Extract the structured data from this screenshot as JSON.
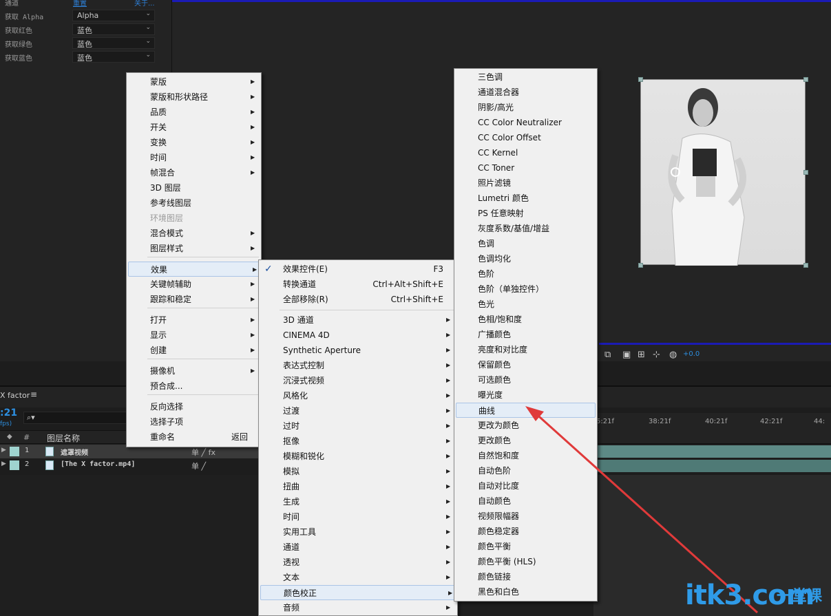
{
  "effect_controls": {
    "top_partial_label": "通道",
    "reset_link": "重置",
    "about_link": "关于...",
    "rows": [
      {
        "label": "获取 Alpha",
        "value": "Alpha"
      },
      {
        "label": "获取红色",
        "value": "蓝色"
      },
      {
        "label": "获取绿色",
        "value": "蓝色"
      },
      {
        "label": "获取蓝色",
        "value": "蓝色"
      }
    ]
  },
  "viewer": {
    "exposure_value": "+0.0"
  },
  "timeline": {
    "tab_label": "X factor",
    "menu_icon": "hamburger-icon",
    "timecode": ":21",
    "fps": "fps)",
    "search_icon": "search-icon",
    "columns": {
      "number": "#",
      "layer_name": "图层名称"
    },
    "layers": [
      {
        "num": "1",
        "name": "遮罩视频",
        "switches": "单  ╱  fx"
      },
      {
        "num": "2",
        "name": "[The X factor.mp4]",
        "switches": "单  ╱"
      }
    ],
    "ruler_ticks": [
      "5:21f",
      "38:21f",
      "40:21f",
      "42:21f",
      "44:"
    ]
  },
  "context_menu": {
    "items": [
      {
        "label": "蒙版",
        "submenu": true
      },
      {
        "label": "蒙版和形状路径",
        "submenu": true
      },
      {
        "label": "品质",
        "submenu": true
      },
      {
        "label": "开关",
        "submenu": true
      },
      {
        "label": "变换",
        "submenu": true
      },
      {
        "label": "时间",
        "submenu": true
      },
      {
        "label": "帧混合",
        "submenu": true
      },
      {
        "label": "3D 图层",
        "submenu": false
      },
      {
        "label": "参考线图层",
        "submenu": false
      },
      {
        "label": "环境图层",
        "submenu": false,
        "disabled": true
      },
      {
        "label": "混合模式",
        "submenu": true
      },
      {
        "label": "图层样式",
        "submenu": true
      },
      {
        "label": "效果",
        "submenu": true,
        "highlighted": true
      },
      {
        "label": "关键帧辅助",
        "submenu": true
      },
      {
        "label": "跟踪和稳定",
        "submenu": true
      },
      {
        "label": "打开",
        "submenu": true
      },
      {
        "label": "显示",
        "submenu": true
      },
      {
        "label": "创建",
        "submenu": true
      },
      {
        "label": "摄像机",
        "submenu": true
      },
      {
        "label": "预合成...",
        "submenu": false
      },
      {
        "label": "反向选择",
        "submenu": false
      },
      {
        "label": "选择子项",
        "submenu": false
      },
      {
        "label": "重命名",
        "shortcut": "返回"
      }
    ]
  },
  "effects_menu": {
    "items": [
      {
        "label": "效果控件(E)",
        "shortcut": "F3",
        "checked": true
      },
      {
        "label": "转换通道",
        "shortcut": "Ctrl+Alt+Shift+E"
      },
      {
        "label": "全部移除(R)",
        "shortcut": "Ctrl+Shift+E"
      },
      {
        "label": "3D 通道",
        "submenu": true
      },
      {
        "label": "CINEMA 4D",
        "submenu": true
      },
      {
        "label": "Synthetic Aperture",
        "submenu": true
      },
      {
        "label": "表达式控制",
        "submenu": true
      },
      {
        "label": "沉浸式视频",
        "submenu": true
      },
      {
        "label": "风格化",
        "submenu": true
      },
      {
        "label": "过渡",
        "submenu": true
      },
      {
        "label": "过时",
        "submenu": true
      },
      {
        "label": "抠像",
        "submenu": true
      },
      {
        "label": "模糊和锐化",
        "submenu": true
      },
      {
        "label": "模拟",
        "submenu": true
      },
      {
        "label": "扭曲",
        "submenu": true
      },
      {
        "label": "生成",
        "submenu": true
      },
      {
        "label": "时间",
        "submenu": true
      },
      {
        "label": "实用工具",
        "submenu": true
      },
      {
        "label": "通道",
        "submenu": true
      },
      {
        "label": "透视",
        "submenu": true
      },
      {
        "label": "文本",
        "submenu": true
      },
      {
        "label": "颜色校正",
        "submenu": true,
        "highlighted": true
      },
      {
        "label": "音频",
        "submenu": true
      }
    ]
  },
  "color_menu": {
    "items": [
      {
        "label": "三色调"
      },
      {
        "label": "通道混合器"
      },
      {
        "label": "阴影/高光"
      },
      {
        "label": "CC Color Neutralizer"
      },
      {
        "label": "CC Color Offset"
      },
      {
        "label": "CC Kernel"
      },
      {
        "label": "CC Toner"
      },
      {
        "label": "照片滤镜"
      },
      {
        "label": "Lumetri 颜色"
      },
      {
        "label": "PS 任意映射"
      },
      {
        "label": "灰度系数/基值/增益"
      },
      {
        "label": "色调"
      },
      {
        "label": "色调均化"
      },
      {
        "label": "色阶"
      },
      {
        "label": "色阶（单独控件）"
      },
      {
        "label": "色光"
      },
      {
        "label": "色相/饱和度"
      },
      {
        "label": "广播颜色"
      },
      {
        "label": "亮度和对比度"
      },
      {
        "label": "保留颜色"
      },
      {
        "label": "可选颜色"
      },
      {
        "label": "曝光度"
      },
      {
        "label": "曲线",
        "highlighted": true
      },
      {
        "label": "更改为颜色"
      },
      {
        "label": "更改颜色"
      },
      {
        "label": "自然饱和度"
      },
      {
        "label": "自动色阶"
      },
      {
        "label": "自动对比度"
      },
      {
        "label": "自动颜色"
      },
      {
        "label": "视频限幅器"
      },
      {
        "label": "颜色稳定器"
      },
      {
        "label": "颜色平衡"
      },
      {
        "label": "颜色平衡 (HLS)"
      },
      {
        "label": "颜色链接"
      },
      {
        "label": "黑色和白色"
      }
    ]
  },
  "watermark": {
    "text": "itk3",
    "suffix": ".com",
    "cn": "一堂课"
  },
  "colors": {
    "accent_blue": "#2d8fe0",
    "annotation_red": "#e03a3a",
    "menu_bg": "#f0f0f0",
    "highlight_bg": "#e4edf7"
  }
}
